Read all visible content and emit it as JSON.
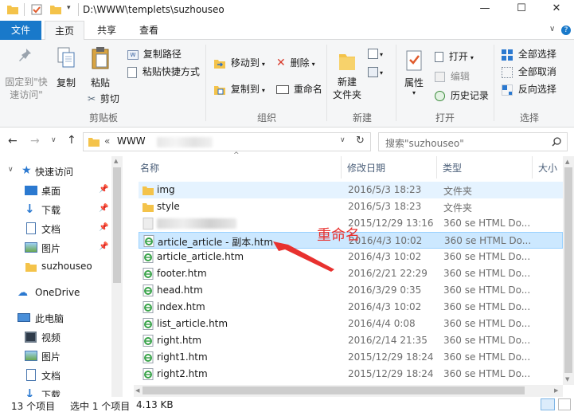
{
  "window": {
    "title": "D:\\WWW\\templets\\suzhouseo",
    "controls": {
      "minimize": "—",
      "maximize": "☐",
      "close": "✕"
    }
  },
  "tabs": {
    "file": "文件",
    "home": "主页",
    "share": "共享",
    "view": "查看"
  },
  "ribbon": {
    "clipboard": {
      "group_label": "剪贴板",
      "pin_line1": "固定到\"快",
      "pin_line2": "速访问\"",
      "copy": "复制",
      "paste": "粘贴",
      "copy_path": "复制路径",
      "paste_shortcut": "粘贴快捷方式",
      "cut": "剪切"
    },
    "organize": {
      "group_label": "组织",
      "move_to": "移动到",
      "copy_to": "复制到",
      "delete": "删除",
      "rename": "重命名"
    },
    "new": {
      "group_label": "新建",
      "new_folder_line1": "新建",
      "new_folder_line2": "文件夹"
    },
    "open": {
      "group_label": "打开",
      "properties": "属性",
      "open": "打开",
      "edit": "编辑",
      "history": "历史记录"
    },
    "select": {
      "group_label": "选择",
      "select_all": "全部选择",
      "select_none": "全部取消",
      "invert": "反向选择"
    }
  },
  "address": {
    "chevron": "«",
    "path": "WWW",
    "search_placeholder": "搜索\"suzhouseo\""
  },
  "nav": {
    "items": [
      {
        "label": "快速访问",
        "icon": "star-icon"
      },
      {
        "label": "桌面",
        "icon": "desktop-icon"
      },
      {
        "label": "下载",
        "icon": "download-icon"
      },
      {
        "label": "文档",
        "icon": "document-icon"
      },
      {
        "label": "图片",
        "icon": "picture-icon"
      },
      {
        "label": "suzhouseo",
        "icon": "folder-icon"
      },
      {
        "label": "OneDrive",
        "icon": "cloud-icon"
      },
      {
        "label": "此电脑",
        "icon": "computer-icon"
      },
      {
        "label": "视频",
        "icon": "video-icon"
      },
      {
        "label": "图片",
        "icon": "picture-icon"
      },
      {
        "label": "文档",
        "icon": "document-icon"
      },
      {
        "label": "下载",
        "icon": "download-icon"
      }
    ]
  },
  "columns": {
    "name": "名称",
    "date": "修改日期",
    "type": "类型",
    "size": "大小"
  },
  "files": [
    {
      "name": "img",
      "date": "2016/5/3 18:23",
      "type": "文件夹",
      "kind": "folder"
    },
    {
      "name": "style",
      "date": "2016/5/3 18:23",
      "type": "文件夹",
      "kind": "folder"
    },
    {
      "name": "",
      "date": "2015/12/29 13:16",
      "type": "360 se HTML Do...",
      "kind": "blurred"
    },
    {
      "name": "article_article - 副本.htm",
      "date": "2016/4/3 10:02",
      "type": "360 se HTML Do...",
      "kind": "html"
    },
    {
      "name": "article_article.htm",
      "date": "2016/4/3 10:02",
      "type": "360 se HTML Do...",
      "kind": "html"
    },
    {
      "name": "footer.htm",
      "date": "2016/2/21 22:29",
      "type": "360 se HTML Do...",
      "kind": "html"
    },
    {
      "name": "head.htm",
      "date": "2016/3/29 0:35",
      "type": "360 se HTML Do...",
      "kind": "html"
    },
    {
      "name": "index.htm",
      "date": "2016/4/3 10:02",
      "type": "360 se HTML Do...",
      "kind": "html"
    },
    {
      "name": "list_article.htm",
      "date": "2016/4/4 0:08",
      "type": "360 se HTML Do...",
      "kind": "html"
    },
    {
      "name": "right.htm",
      "date": "2016/2/14 21:35",
      "type": "360 se HTML Do...",
      "kind": "html"
    },
    {
      "name": "right1.htm",
      "date": "2015/12/29 18:24",
      "type": "360 se HTML Do...",
      "kind": "html"
    },
    {
      "name": "right2.htm",
      "date": "2015/12/29 18:24",
      "type": "360 se HTML Do...",
      "kind": "html"
    }
  ],
  "annotation": {
    "text": "重命名",
    "color": "#e8312f"
  },
  "status": {
    "count": "13 个项目",
    "selected": "选中 1 个项目",
    "size": "4.13 KB"
  },
  "colors": {
    "accent": "#1979ca",
    "selection": "#cce8ff",
    "hover": "#e5f3ff",
    "folder": "#f4c34a",
    "html_icon": "#3aa34a"
  }
}
